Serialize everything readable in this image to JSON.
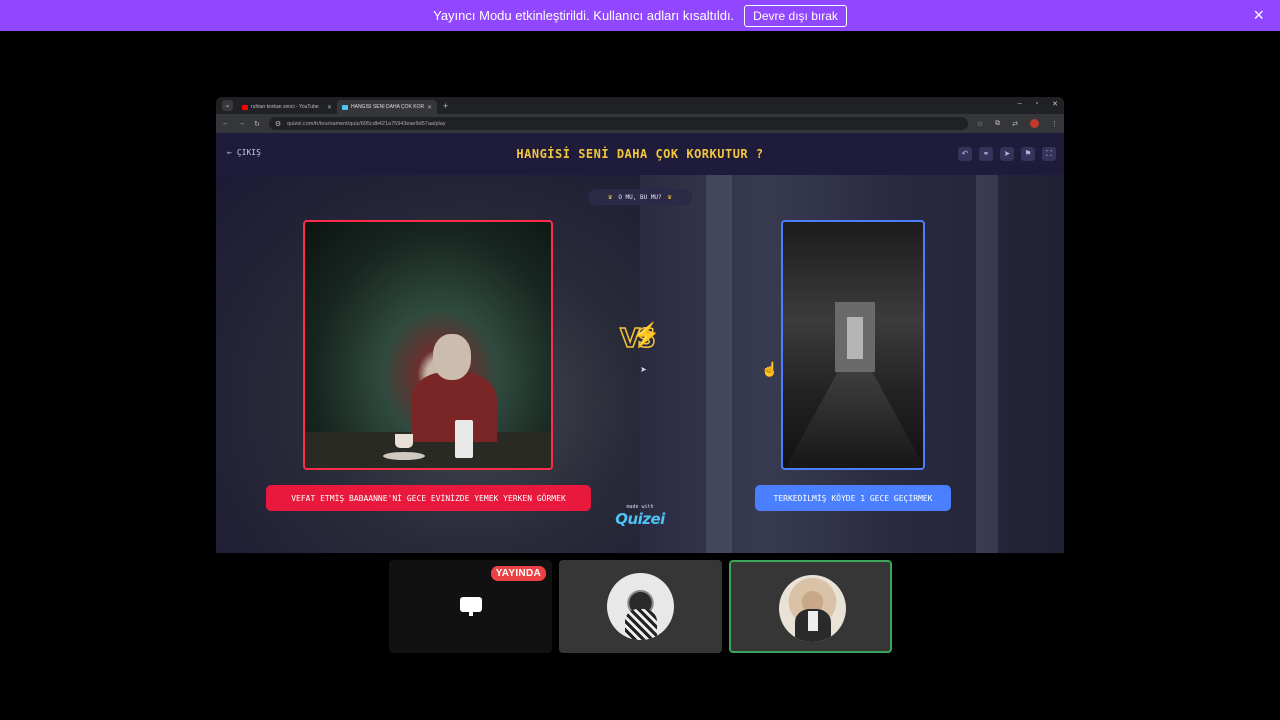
{
  "banner": {
    "message": "Yayıncı Modu etkinleştirildi. Kullanıcı adları kısaltıldı.",
    "disable_label": "Devre dışı bırak",
    "close_icon": "×"
  },
  "browser": {
    "tabs": [
      {
        "title": "ruhtan korkan zenci - YouTube",
        "favicon_color": "#ff0000"
      },
      {
        "title": "HANGISI SENI DAHA ÇOK KORK",
        "favicon_color": "#4ec3f5"
      }
    ],
    "url": "quizei.com/tr/tournament/quiz/695cdb421a75943eae9d57aa/play"
  },
  "quiz": {
    "exit_label": "ÇIKIŞ",
    "title": "HANGİSİ SENİ DAHA ÇOK KORKUTUR ?",
    "round_label": "O MU, BU MU?",
    "vs_text": "VS",
    "left_option": "VEFAT ETMİŞ BABAANNE'Nİ GECE EVİNİZDE YEMEK YERKEN GÖRMEK",
    "right_option": "TERKEDİLMİŞ KÖYDE 1 GECE GEÇİRMEK",
    "made_with": "made with",
    "brand": "Quizei",
    "colors": {
      "left": "#e8193c",
      "right": "#4a80ff",
      "title": "#f2c53d"
    }
  },
  "call": {
    "live_badge": "YAYINDA",
    "participants": [
      {
        "type": "screen-share",
        "icon": "monitor-icon"
      },
      {
        "type": "user",
        "avatar": "keffiyeh-avatar",
        "speaking": false
      },
      {
        "type": "user",
        "avatar": "cat-in-suit-avatar",
        "speaking": true
      }
    ]
  }
}
